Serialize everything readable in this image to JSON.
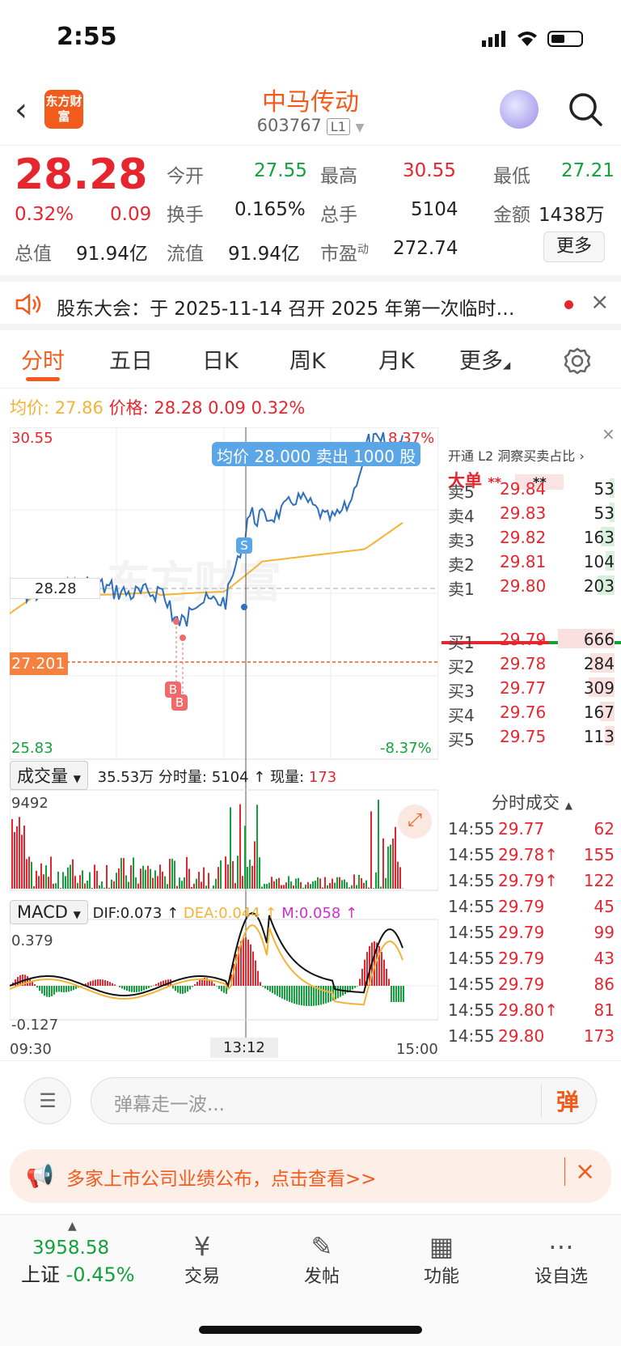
{
  "status_bar": {
    "time": "2:55"
  },
  "header": {
    "logo_text": "东方财富",
    "stock_name": "中马传动",
    "stock_code": "603767",
    "level": "L1"
  },
  "quote": {
    "price": "28.28",
    "change_pct": "0.32%",
    "change": "0.09",
    "open_label": "今开",
    "open": "27.55",
    "high_label": "最高",
    "high": "30.55",
    "low_label": "最低",
    "low": "27.21",
    "turnover_label": "换手",
    "turnover": "0.165%",
    "volume_label": "总手",
    "volume": "5104",
    "amount_label": "金额",
    "amount": "1438万",
    "mktcap_label": "总值",
    "mktcap": "91.94亿",
    "float_label": "流值",
    "float": "91.94亿",
    "pe_label": "市盈",
    "pe_sup": "动",
    "pe": "272.74",
    "more_label": "更多"
  },
  "notice": {
    "text": "股东大会：于 2025-11-14 召开 2025 年第一次临时…"
  },
  "tabs": [
    {
      "label": "分时"
    },
    {
      "label": "五日"
    },
    {
      "label": "日K"
    },
    {
      "label": "周K"
    },
    {
      "label": "月K"
    },
    {
      "label": "更多"
    }
  ],
  "avg_bar": {
    "avg_label": "均价:",
    "avg": "27.86",
    "price_label": "价格:",
    "price": "28.28",
    "change": "0.09",
    "pct": "0.32%"
  },
  "chart": {
    "y_top": "30.55",
    "y_bottom": "25.83",
    "pct_top": "8.37%",
    "pct_bottom": "-8.37%",
    "cur_price_tag": "28.28",
    "prev_close_tag": "27.201",
    "tooltip": "均价 28.000  卖出 1000 股",
    "marker_s": "S",
    "marker_b": "B",
    "watermark": "东方财富",
    "times": {
      "start": "09:30",
      "cursor": "13:12",
      "end": "15:00"
    }
  },
  "volume": {
    "selector": "成交量",
    "total": "35.53万",
    "label1": "分时量:",
    "val1": "5104",
    "label2": "现量:",
    "val2": "173",
    "max": "9492"
  },
  "macd": {
    "selector": "MACD",
    "dif": "DIF:0.073",
    "dea": "DEA:0.044",
    "m": "M:0.058",
    "top": "0.379",
    "bottom": "-0.127"
  },
  "orderbook": {
    "l2_label": "开通 L2 洞察买卖占比",
    "big_label": "大单",
    "big_val1": "**",
    "big_val2": "**",
    "asks": [
      {
        "label": "卖5",
        "price": "29.84",
        "qty": "53"
      },
      {
        "label": "卖4",
        "price": "29.83",
        "qty": "53"
      },
      {
        "label": "卖3",
        "price": "29.82",
        "qty": "163"
      },
      {
        "label": "卖2",
        "price": "29.81",
        "qty": "104"
      },
      {
        "label": "卖1",
        "price": "29.80",
        "qty": "203"
      }
    ],
    "bids": [
      {
        "label": "买1",
        "price": "29.79",
        "qty": "666"
      },
      {
        "label": "买2",
        "price": "29.78",
        "qty": "284"
      },
      {
        "label": "买3",
        "price": "29.77",
        "qty": "309"
      },
      {
        "label": "买4",
        "price": "29.76",
        "qty": "167"
      },
      {
        "label": "买5",
        "price": "29.75",
        "qty": "113"
      }
    ],
    "trades_label": "分时成交",
    "trades": [
      {
        "time": "14:55",
        "price": "29.77",
        "qty": "62"
      },
      {
        "time": "14:55",
        "price": "29.78↑",
        "qty": "155"
      },
      {
        "time": "14:55",
        "price": "29.79↑",
        "qty": "122"
      },
      {
        "time": "14:55",
        "price": "29.79",
        "qty": "45"
      },
      {
        "time": "14:55",
        "price": "29.79",
        "qty": "99"
      },
      {
        "time": "14:55",
        "price": "29.79",
        "qty": "43"
      },
      {
        "time": "14:55",
        "price": "29.79",
        "qty": "86"
      },
      {
        "time": "14:55",
        "price": "29.80↑",
        "qty": "81"
      },
      {
        "time": "14:55",
        "price": "29.80",
        "qty": "173"
      }
    ]
  },
  "comment": {
    "placeholder": "弹幕走一波...",
    "send_label": "弹"
  },
  "banner": {
    "text": "多家上市公司业绩公布，点击查看>>"
  },
  "tabbar": {
    "index_value": "3958.58",
    "index_name": "上证",
    "index_pct": "-0.45%",
    "items": [
      {
        "label": "交易"
      },
      {
        "label": "发帖"
      },
      {
        "label": "功能"
      },
      {
        "label": "设自选"
      }
    ]
  },
  "colors": {
    "up": "#e6262e",
    "down": "#13a13c",
    "brand": "#f25b1c",
    "price_line": "#2f6fbd",
    "avg_line": "#f5b335"
  }
}
